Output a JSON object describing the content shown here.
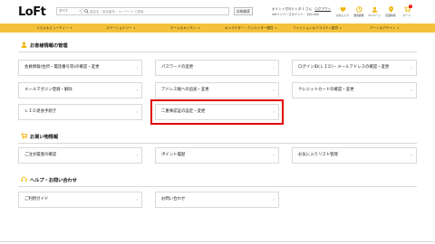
{
  "brand": {
    "logo_text": "LoFt",
    "accent_color": "#f4c23a",
    "highlight_color": "#e00000"
  },
  "header": {
    "search_category": "すべて",
    "search_placeholder": "製品名・製品番号・キーワードで検索",
    "detail_search_label": "詳細検索",
    "user_points_text": "ポイント付与ドトタ 1 さん",
    "logout_label": "ログアウト",
    "user_sub_text": "loftメンバーズポイント：100,000",
    "icons": [
      {
        "name": "favorite-icon",
        "label": "お気に入り"
      },
      {
        "name": "history-icon",
        "label": "閲覧履歴"
      },
      {
        "name": "mypage-icon",
        "label": "マイページ"
      },
      {
        "name": "store-icon",
        "label": "店舗情報"
      },
      {
        "name": "cart-icon",
        "label": "カート"
      }
    ],
    "cart_count": "0"
  },
  "nav": {
    "items": [
      {
        "label": "コスメ＆ビューティー"
      },
      {
        "label": "ステーショナリー"
      },
      {
        "label": "ホーム＆キッチン"
      },
      {
        "label": "キャラクター・クリエイター雑貨"
      },
      {
        "label": "ファッション＆バラエティ雑貨"
      },
      {
        "label": "アート＆デザイン"
      }
    ]
  },
  "sections": {
    "customer": {
      "title": "お客様情報の管理",
      "items": [
        "会員情報(住所・電話番号等)の確認・変更",
        "パスワードの変更",
        "ログインID(ＬＩＤ)・メールアドレスの確認・変更",
        "メールマガジン登録・解除",
        "アドレス帳への追加・変更",
        "クレジットカードの確認・変更",
        "ＬＩＤ退会手続き",
        "二重事認証の設定・変更"
      ]
    },
    "shopping": {
      "title": "お買い物情報",
      "items": [
        "ご注文履歴の確認",
        "ポイント履歴",
        "お気に入りリスト管理"
      ]
    },
    "help": {
      "title": "ヘルプ・お問い合わせ",
      "items": [
        "ご利用ガイド",
        "お問い合わせ"
      ]
    }
  }
}
